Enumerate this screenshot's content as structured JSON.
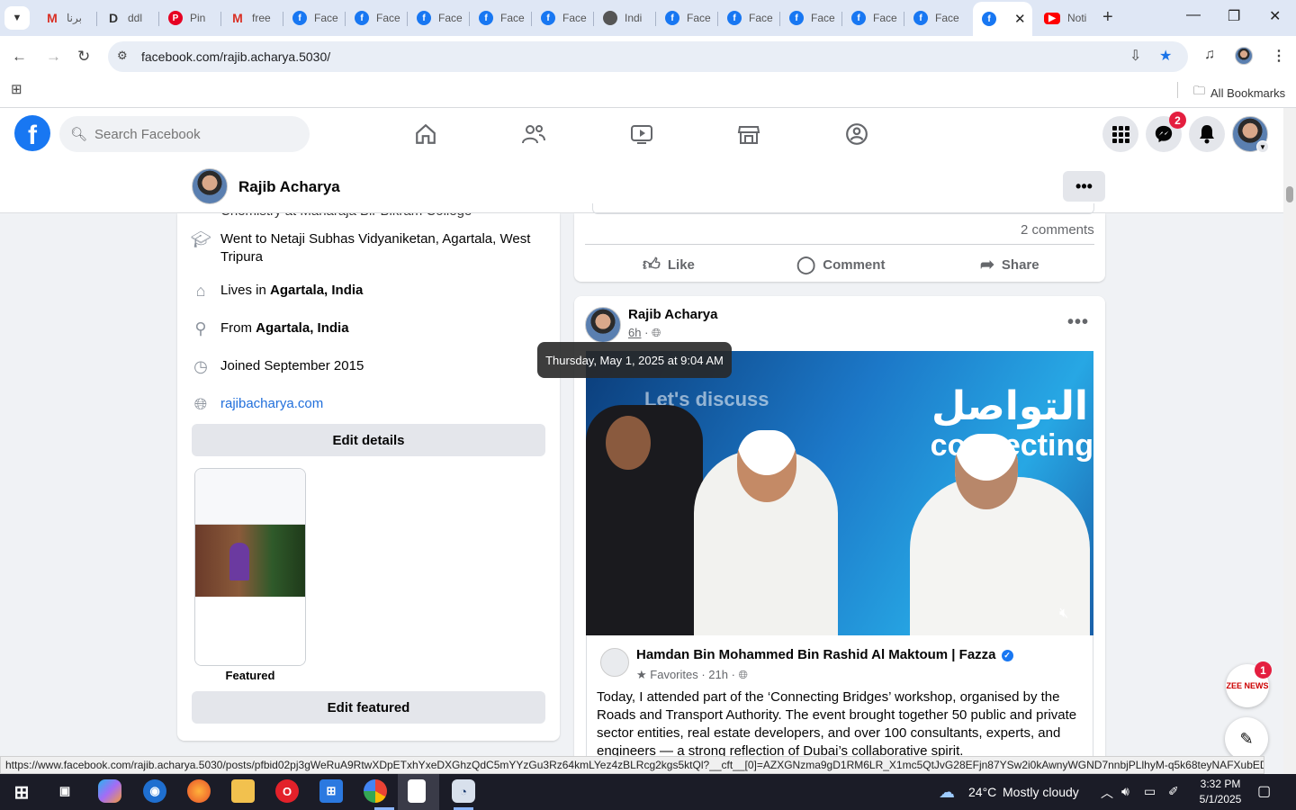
{
  "browser": {
    "tabs": [
      {
        "label": "برنا",
        "icon": "gmail-icon"
      },
      {
        "label": "ddl",
        "icon": "doc-icon"
      },
      {
        "label": "Pin",
        "icon": "pinterest-icon"
      },
      {
        "label": "free",
        "icon": "gmail-icon"
      },
      {
        "label": "Face",
        "icon": "facebook-icon"
      },
      {
        "label": "Face",
        "icon": "facebook-icon"
      },
      {
        "label": "Face",
        "icon": "facebook-icon"
      },
      {
        "label": "Face",
        "icon": "facebook-icon"
      },
      {
        "label": "Face",
        "icon": "facebook-icon"
      },
      {
        "label": "Indi",
        "icon": "globe-icon"
      },
      {
        "label": "Face",
        "icon": "facebook-icon"
      },
      {
        "label": "Face",
        "icon": "facebook-icon"
      },
      {
        "label": "Face",
        "icon": "facebook-icon"
      },
      {
        "label": "Face",
        "icon": "facebook-icon"
      },
      {
        "label": "Face",
        "icon": "facebook-icon"
      },
      {
        "label": "",
        "icon": "facebook-icon",
        "active": true
      },
      {
        "label": "Noti",
        "icon": "youtube-icon"
      }
    ],
    "url": "facebook.com/rajib.acharya.5030/",
    "bookmarks_label": "All Bookmarks",
    "status_url": "https://www.facebook.com/rajib.acharya.5030/posts/pfbid02pj3gWeRuA9RtwXDpETxhYxeDXGhzQdC5mYYzGu3Rz64kmLYez4zBLRcg2kgs5ktQl?__cft__[0]=AZXGNzma9gD1RM6LR_X1mc5QtJvG28EFjn87YSw2i0kAwnyWGND7nnbjPLlhyM-q5k68teyNAFXubEDwSgU5f..."
  },
  "facebook": {
    "search_placeholder": "Search Facebook",
    "messenger_badge": "2",
    "profile_name": "Rajib Acharya",
    "intro": {
      "cut_line": "Chemistry at Maharaja Bir Bikram College",
      "education": "Went to Netaji Subhas Vidyaniketan, Agartala, West Tripura",
      "lives_prefix": "Lives in ",
      "lives_place": "Agartala, India",
      "from_prefix": "From ",
      "from_place": "Agartala, India",
      "joined": "Joined September 2015",
      "website": "rajibacharya.com",
      "edit_details": "Edit details",
      "featured_label": "Featured",
      "edit_featured": "Edit featured"
    },
    "post1": {
      "comments": "2 comments",
      "like": "Like",
      "comment": "Comment",
      "share": "Share"
    },
    "post2": {
      "author": "Rajib Acharya",
      "time": "6h",
      "tooltip": "Thursday, May 1, 2025 at 9:04 AM",
      "image_text_arabic": "التواصل",
      "image_text_en": "connecting",
      "image_text_left": "Let's discuss",
      "shared_author": "Hamdan Bin Mohammed Bin Rashid Al Maktoum | Fazza",
      "shared_meta": "Favorites · 21h ·",
      "text": "Today, I attended part of the ‘Connecting Bridges’ workshop, organised by the Roads and Transport Authority. The event brought together 50 public and private sector entities, real estate developers, and over 100 consultants, experts, and engineers — a strong reflection of Dubai’s collaborative spirit."
    },
    "zee_badge": "1",
    "zee_label": "ZEE NEWS"
  },
  "taskbar": {
    "temperature": "24°C",
    "weather": "Mostly cloudy",
    "time": "3:32 PM",
    "date": "5/1/2025"
  }
}
